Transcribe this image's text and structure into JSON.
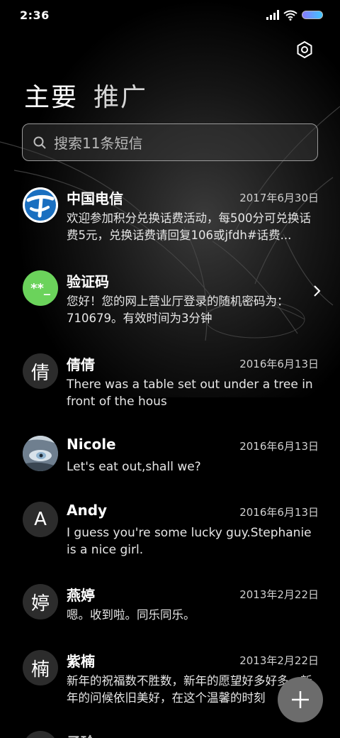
{
  "status_bar": {
    "time": "2:36",
    "icons": [
      "signal-icon",
      "wifi-icon",
      "battery-icon"
    ]
  },
  "header": {
    "tabs": [
      {
        "label": "主要",
        "active": true
      },
      {
        "label": "推广",
        "active": false
      }
    ],
    "settings_icon": "settings-icon"
  },
  "search": {
    "placeholder": "搜索11条短信"
  },
  "messages": [
    {
      "sender": "中国电信",
      "date": "2017年6月30日",
      "preview": "欢迎参加积分兑换话费活动，每500分可兑换话费5元，兑换话费请回复106或jfdh#话费...",
      "avatar": "china-telecom-logo"
    },
    {
      "sender": "验证码",
      "date": "",
      "preview": "您好！您的网上营业厅登录的随机密码为：710679。有效时间为3分钟",
      "avatar_text": "**_",
      "avatar_color": "#6bd35b"
    },
    {
      "sender": "倩倩",
      "date": "2016年6月13日",
      "preview": "There was a table set out under a tree in front of the hous",
      "avatar_text": "倩"
    },
    {
      "sender": "Nicole",
      "date": "2016年6月13日",
      "preview": "Let's eat out,shall we?",
      "avatar": "photo"
    },
    {
      "sender": "Andy",
      "date": "2016年6月13日",
      "preview": "I guess you're some lucky guy.Stephanie is a nice girl.",
      "avatar_text": "A"
    },
    {
      "sender": "燕婷",
      "date": "2013年2月22日",
      "preview": "嗯。收到啦。同乐同乐。",
      "avatar_text": "婷"
    },
    {
      "sender": "紫楠",
      "date": "2013年2月22日",
      "preview": "新年的祝福数不胜数，新年的愿望好多好多，新年的问候依旧美好，在这个温馨的时刻",
      "avatar_text": "楠"
    },
    {
      "sender": "子玲",
      "date": "",
      "preview": "",
      "avatar_text": ""
    }
  ],
  "fab": {
    "icon": "plus-icon"
  },
  "colors": {
    "background": "#000000",
    "accent_green": "#6bd35b",
    "telecom_blue": "#1a6fc0"
  }
}
